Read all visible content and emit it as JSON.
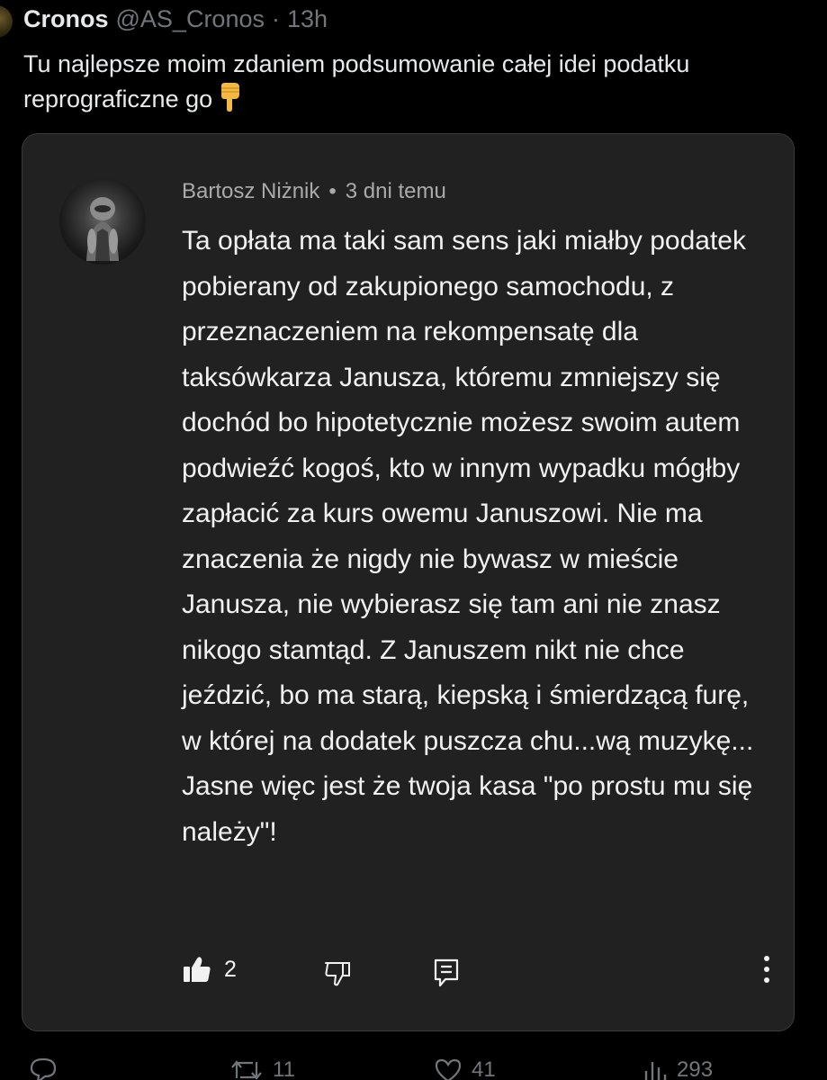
{
  "tweet": {
    "author": "Cronos",
    "handle": "@AS_Cronos",
    "separator": "·",
    "time": "13h",
    "text": "Tu najlepsze moim zdaniem podsumowanie całej idei podatku reprograficzne go",
    "emoji_icon": "pointing-down-hand-icon"
  },
  "comment": {
    "author": "Bartosz Niżnik",
    "separator": "•",
    "time": "3 dni temu",
    "body": "Ta opłata ma taki sam sens jaki miałby podatek pobierany od zakupionego samochodu, z przeznaczeniem na rekompensatę dla taksówkarza Janusza, któremu zmniejszy się dochód bo hipotetycznie możesz swoim autem podwieźć kogoś, kto w innym wypadku mógłby zapłacić za kurs owemu Januszowi. Nie ma znaczenia że nigdy nie bywasz w mieście Janusza, nie wybierasz się tam ani nie znasz nikogo stamtąd. Z Januszem nikt nie chce jeździć, bo ma starą, kiepską i śmierdzącą furę, w której na dodatek puszcza chu...wą muzykę... Jasne więc jest że twoja kasa \"po prostu mu się należy\"!",
    "likes": "2",
    "icons": [
      "thumbs-up-icon",
      "thumbs-down-icon",
      "reply-icon",
      "more-vertical-icon"
    ]
  },
  "footer": {
    "replies": "",
    "retweets": "11",
    "likes": "41",
    "views": "293"
  },
  "colors": {
    "background": "#000000",
    "card": "#212121",
    "text": "#e7e9ea",
    "muted": "#71767b",
    "emoji": "#f4b942"
  }
}
